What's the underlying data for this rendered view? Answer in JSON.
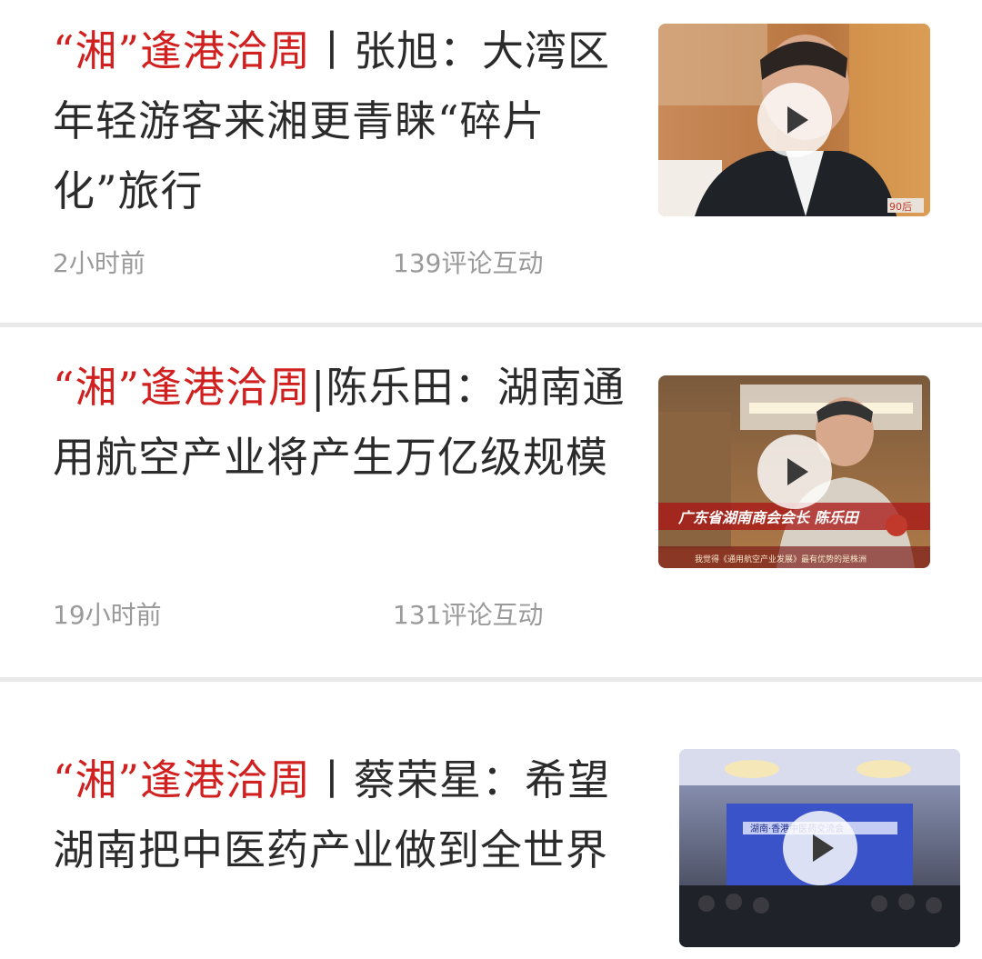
{
  "feed": {
    "items": [
      {
        "title_highlight": "“湘”逢港洽周",
        "title_rest": "丨张旭：大湾区年轻游客来湘更青睐“碎片化”旅行",
        "time": "2小时前",
        "comments": "139评论互动",
        "thumbnail_icon": "play-icon",
        "caption": "",
        "subcaption": "",
        "badge": "90后"
      },
      {
        "title_highlight": "“湘”逢港洽周",
        "title_rest": "|陈乐田：湖南通用航空产业将产生万亿级规模",
        "time": "19小时前",
        "comments": "131评论互动",
        "thumbnail_icon": "play-icon",
        "caption": "广东省湖南商会会长 陈乐田",
        "subcaption": "我觉得《通用航空产业发展》最有优势的是株洲"
      },
      {
        "title_highlight": "“湘”逢港洽周",
        "title_rest": "丨蔡荣星：希望湖南把中医药产业做到全世界",
        "thumbnail_icon": "play-icon",
        "screen_text": "湖南·香港中医药交流会"
      }
    ]
  },
  "colors": {
    "highlight": "#d0201f",
    "title": "#2b2b2b",
    "meta": "#9a9a9a",
    "divider": "#e9e9ea"
  }
}
